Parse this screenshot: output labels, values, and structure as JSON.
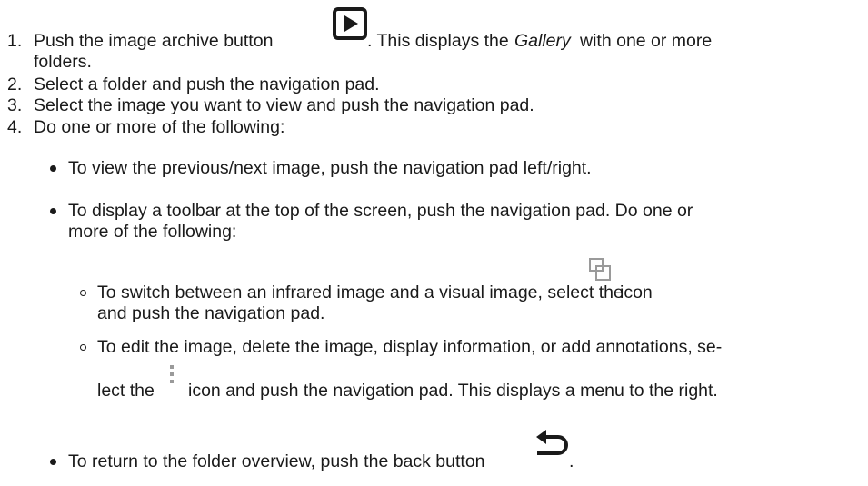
{
  "steps": [
    {
      "number": "1.",
      "text_a": "Push the image archive button",
      "text_b": ". This displays the",
      "gallery_word": "Gallery",
      "text_c": "with one or more",
      "text_d": "folders."
    },
    {
      "number": "2.",
      "text": "Select a folder and push the navigation pad."
    },
    {
      "number": "3.",
      "text": "Select the image you want to view and push the navigation pad."
    },
    {
      "number": "4.",
      "text": "Do one or more of the following:"
    }
  ],
  "bullets": [
    {
      "text": "To view the previous/next image, push the navigation pad left/right."
    },
    {
      "line1": "To display a toolbar at the top of the screen, push the navigation pad. Do one or",
      "line2": "more of the following:"
    },
    {
      "text": "To return to the folder overview, push the back button",
      "end": "."
    }
  ],
  "sub_bullets": [
    {
      "line1_a": "To switch between an infrared image and a visual image, select the",
      "line1_b": "icon",
      "line2": "and push the navigation pad."
    },
    {
      "line1": "To edit the image, delete the image, display information, or add annotations, se-",
      "line2_a": "lect the",
      "line2_b": "icon and push the navigation pad. This displays a menu to the right."
    }
  ],
  "icons": {
    "archive": "play-button-icon",
    "switch": "switch-image-icon",
    "menu": "vertical-dots-menu-icon",
    "back": "back-arrow-icon"
  }
}
